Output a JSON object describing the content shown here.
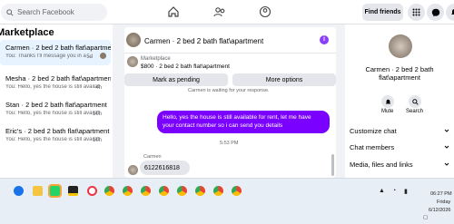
{
  "topbar": {
    "search_placeholder": "Search Facebook",
    "find_friends_label": "Find friends"
  },
  "left": {
    "title": "Marketplace",
    "conversations": [
      {
        "title": "Carmen · 2 bed 2 bath flat\\apartment",
        "preview": "You: Thanks I'll message you in a ...",
        "time": "5d"
      },
      {
        "title": "Mesha · 2 bed 2 bath flat\\apartment",
        "preview": "You: Hello, yes the house is still available ...",
        "time": "4h"
      },
      {
        "title": "Stan · 2 bed 2 bath flat\\apartment",
        "preview": "You: Hello, yes the house is still available ...",
        "time": "10h"
      },
      {
        "title": "Eric's · 2 bed 2 bath flat\\apartment",
        "preview": "You: Hello, yes the house is still available ...",
        "time": "10h"
      }
    ]
  },
  "chat": {
    "header_name": "Carmen · 2 bed 2 bath flat\\apartment",
    "info_glyph": "i",
    "listing_source": "Marketplace",
    "listing_title": "$800 · 2 bed 2 bath flat\\apartment",
    "mark_pending_label": "Mark as pending",
    "more_options_label": "More options",
    "waiting_text": "Carmen is waiting for your response.",
    "outgoing_message": "Hello, yes the house is still available for rent, let me have your contact number so i can send you details",
    "timestamp": "5:53 PM",
    "incoming_sender": "Carmen",
    "incoming_message": "6122616818"
  },
  "right": {
    "name": "Carmen · 2 bed 2 bath flat\\apartment",
    "mute_label": "Mute",
    "search_label": "Search",
    "sections": [
      "Customize chat",
      "Chat members",
      "Media, files and links"
    ]
  },
  "taskbar": {
    "time": "06:27 PM",
    "day": "Friday",
    "date": "6/12/2026"
  },
  "colors": {
    "accent": "#7a00ff",
    "fb_bg": "#f0f2f5"
  }
}
